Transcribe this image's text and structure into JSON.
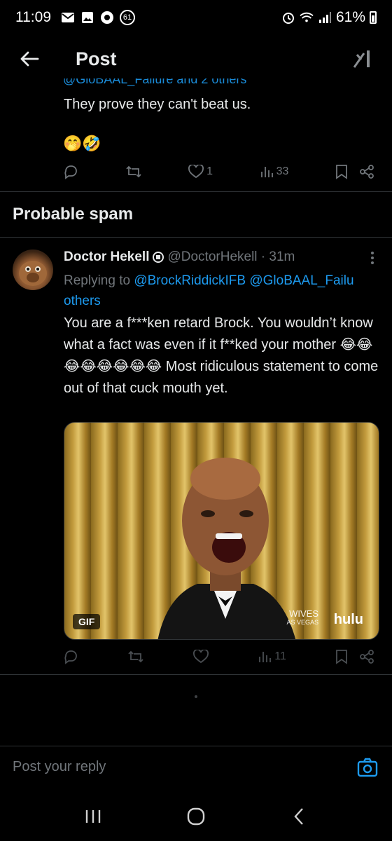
{
  "status_bar": {
    "time": "11:09",
    "notification_badge": "61",
    "battery": "61%"
  },
  "header": {
    "title": "Post",
    "back_icon": "arrow-left-icon",
    "grok_icon": "grok-icon"
  },
  "previous_reply": {
    "cutoff_text": "@GloBAAL_Failure and 2 others",
    "text": "They prove they can't beat us.",
    "emojis": "🤭🤣",
    "stats": {
      "likes": "1",
      "views": "33"
    }
  },
  "section": {
    "title": "Probable spam"
  },
  "post": {
    "author_name": "Doctor Hekell",
    "handle_time": "@DoctorHekell · 31m",
    "replying_prefix": "Replying to",
    "mention_1": "@BrockRiddickIFB",
    "mention_2": "@GloBAAL_Failu",
    "replying_rest": "others",
    "body": "You are a f***ken retard Brock. You wouldn’t know what a fact was even if it f**ked your mother 😂😂😂😂😂😂😂😂 Most ridiculous statement to come out of that cuck mouth yet.",
    "media": {
      "badge": "GIF",
      "watermark_show": "WIVES",
      "watermark_show_sub": "AS VEGAS",
      "watermark_brand": "hulu"
    },
    "stats": {
      "views": "11"
    }
  },
  "reply_bar": {
    "placeholder": "Post your reply"
  },
  "colors": {
    "background": "#000000",
    "text": "#e7e9ea",
    "muted": "#71767b",
    "accent": "#1d9bf0",
    "divider": "#2f3336"
  }
}
